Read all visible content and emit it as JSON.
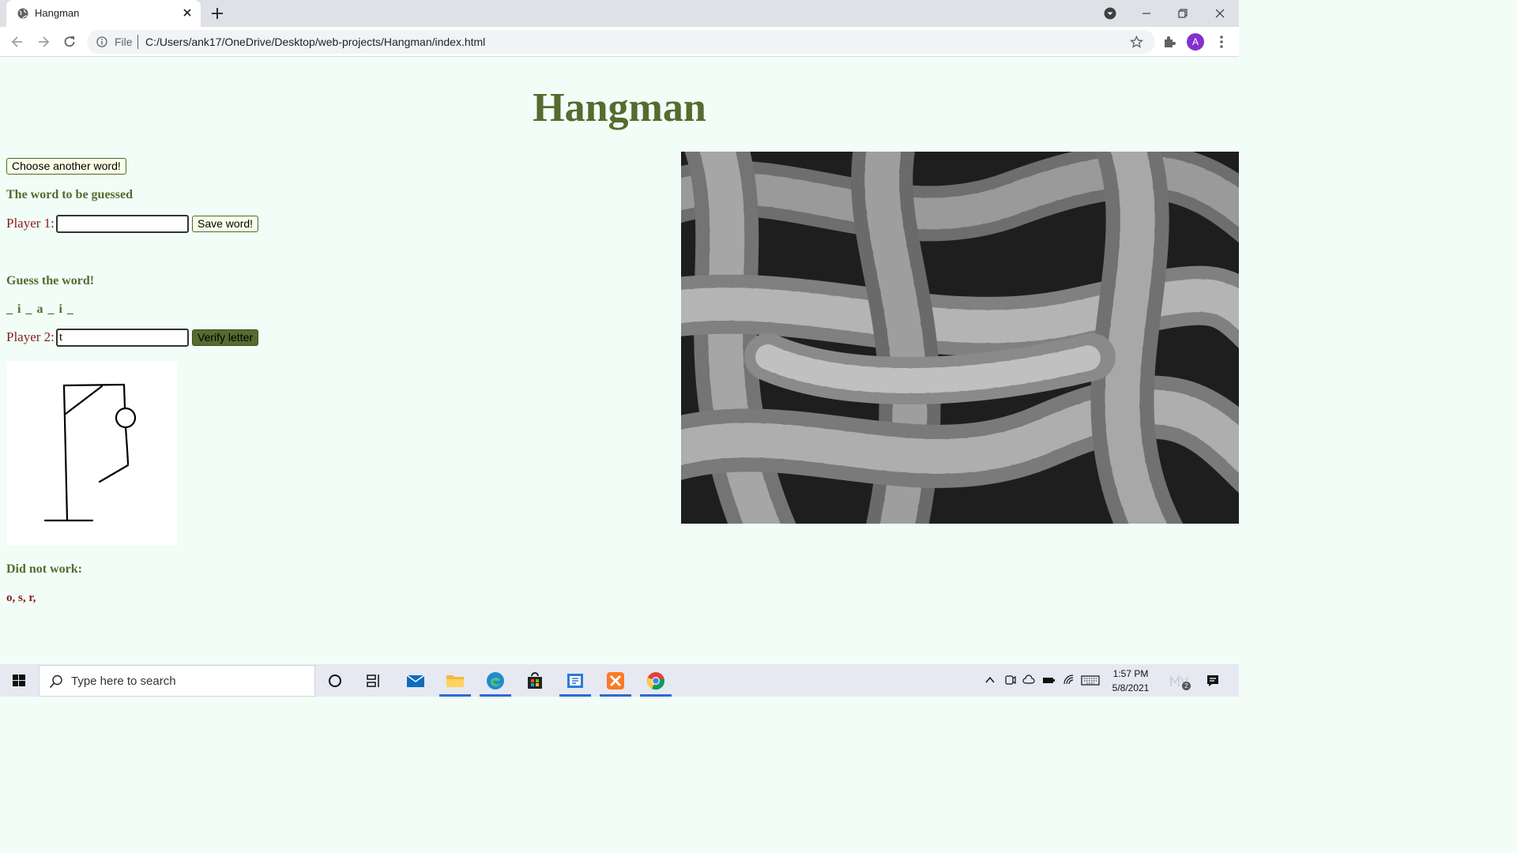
{
  "browser": {
    "tab_title": "Hangman",
    "file_label": "File",
    "url": "C:/Users/ank17/OneDrive/Desktop/web-projects/Hangman/index.html",
    "avatar_letter": "A"
  },
  "page": {
    "title": "Hangman",
    "choose_button": "Choose another word!",
    "word_heading": "The word to be guessed",
    "player1_label": "Player 1:",
    "player1_value": "",
    "save_button": "Save word!",
    "guess_heading": "Guess the word!",
    "masked_word": "_ i _ a _ i _",
    "player2_label": "Player 2:",
    "player2_value": "t",
    "verify_button": "Verify letter",
    "failed_heading": "Did not work:",
    "failed_letters": "o, s, r,"
  },
  "taskbar": {
    "search_placeholder": "Type here to search",
    "time": "1:57 PM",
    "date": "5/8/2021",
    "notification_count": "2"
  },
  "colors": {
    "page_bg": "#f1fdf6",
    "title_green": "#556b2f",
    "label_red": "#8b1a1a"
  }
}
